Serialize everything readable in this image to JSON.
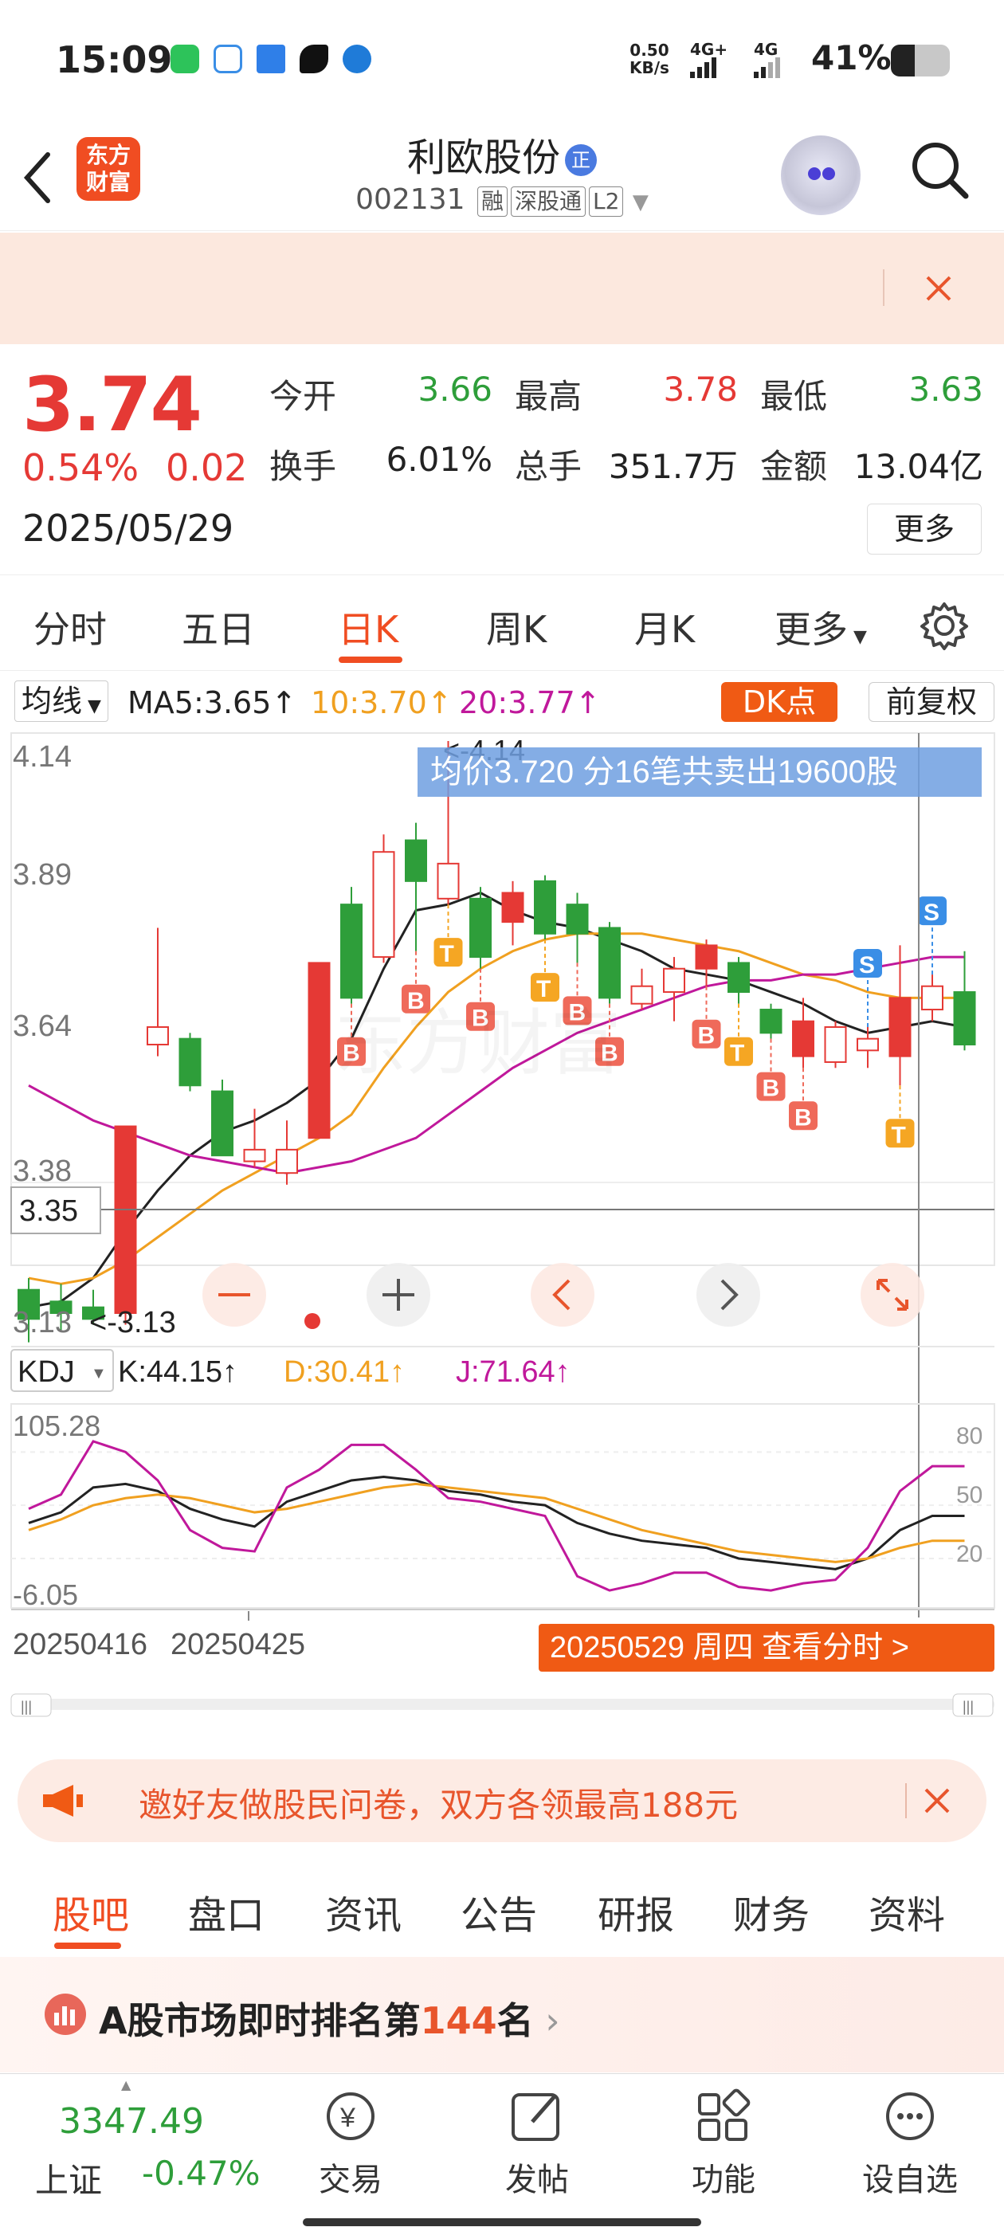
{
  "status": {
    "time": "15:09",
    "net_speed_value": "0.50",
    "net_speed_unit": "KB/s",
    "sig1": "4G+",
    "sig2": "4G",
    "battery": "41%",
    "battery_level": 0.41
  },
  "header": {
    "logo_line1": "东方",
    "logo_line2": "财富",
    "stock_name": "利欧股份",
    "badge": "正",
    "code": "002131",
    "tags": [
      "融",
      "深股通",
      "L2"
    ]
  },
  "quote": {
    "price": "3.74",
    "change_pct": "0.54%",
    "change": "0.02",
    "date": "2025/05/29",
    "fields": [
      {
        "key": "今开",
        "value": "3.66",
        "color": "#2e9e3a"
      },
      {
        "key": "最高",
        "value": "3.78",
        "color": "#e53935"
      },
      {
        "key": "最低",
        "value": "3.63",
        "color": "#2e9e3a"
      },
      {
        "key": "换手",
        "value": "6.01%",
        "color": "#222222"
      },
      {
        "key": "总手",
        "value": "351.7万",
        "color": "#222222"
      },
      {
        "key": "金额",
        "value": "13.04亿",
        "color": "#222222"
      }
    ],
    "more": "更多"
  },
  "tabs": [
    "分时",
    "五日",
    "日K",
    "周K",
    "月K",
    "更多"
  ],
  "active_tab": "日K",
  "ma": {
    "selector": "均线",
    "ma5": "MA5:3.65",
    "ma10": "10:3.70",
    "ma20": "20:3.77",
    "dk": "DK点",
    "fq": "前复权"
  },
  "kline": {
    "y_labels": [
      "4.14",
      "3.89",
      "3.64",
      "3.38",
      "3.13"
    ],
    "crosshair_price": "3.35",
    "high_marker": "<-4.14",
    "low_marker": "<-3.13",
    "tooltip": "均价3.720  分16笔共卖出19600股"
  },
  "kdj": {
    "selector": "KDJ",
    "k": "K:44.15",
    "d": "D:30.41",
    "j": "J:71.64",
    "y_top": "105.28",
    "y_bottom": "-6.05",
    "levels": [
      "80",
      "50",
      "20"
    ]
  },
  "x_axis": {
    "labels": [
      "20250416",
      "20250425"
    ],
    "current": "20250529 周四 查看分时 >"
  },
  "promo": {
    "text": "邀好友做股民问卷，双方各领最高188元"
  },
  "section_tabs": [
    "股吧",
    "盘口",
    "资讯",
    "公告",
    "研报",
    "财务",
    "资料"
  ],
  "active_section": "股吧",
  "rank": {
    "prefix": "A股市场即时排名第",
    "number": "144",
    "suffix": "名"
  },
  "bottom": {
    "index_value": "3347.49",
    "index_name": "上证",
    "index_change": "-0.47%",
    "items": [
      "交易",
      "发帖",
      "功能",
      "设自选"
    ]
  },
  "colors": {
    "up": "#e53935",
    "down": "#2e9e3a",
    "accent": "#f04d22",
    "ma5": "#222222",
    "ma10": "#f0a020",
    "ma20": "#c0189b"
  },
  "chart_data": {
    "type": "candlestick",
    "x_start": "20250416",
    "x_end": "20250529",
    "ylim": [
      3.13,
      4.14
    ],
    "candles": [
      {
        "o": 3.2,
        "c": 3.15,
        "h": 3.22,
        "l": 3.11
      },
      {
        "o": 3.18,
        "c": 3.16,
        "h": 3.21,
        "l": 3.13
      },
      {
        "o": 3.17,
        "c": 3.15,
        "h": 3.2,
        "l": 3.14
      },
      {
        "o": 3.16,
        "c": 3.48,
        "h": 3.48,
        "l": 3.14
      },
      {
        "o": 3.62,
        "c": 3.65,
        "h": 3.82,
        "l": 3.6
      },
      {
        "o": 3.63,
        "c": 3.55,
        "h": 3.64,
        "l": 3.54
      },
      {
        "o": 3.54,
        "c": 3.43,
        "h": 3.56,
        "l": 3.43
      },
      {
        "o": 3.42,
        "c": 3.44,
        "h": 3.51,
        "l": 3.41
      },
      {
        "o": 3.4,
        "c": 3.44,
        "h": 3.49,
        "l": 3.38
      },
      {
        "o": 3.46,
        "c": 3.76,
        "h": 3.76,
        "l": 3.46
      },
      {
        "o": 3.86,
        "c": 3.7,
        "h": 3.89,
        "l": 3.69
      },
      {
        "o": 3.77,
        "c": 3.95,
        "h": 3.98,
        "l": 3.76
      },
      {
        "o": 3.97,
        "c": 3.9,
        "h": 4.0,
        "l": 3.78
      },
      {
        "o": 3.87,
        "c": 3.93,
        "h": 4.14,
        "l": 3.86
      },
      {
        "o": 3.87,
        "c": 3.77,
        "h": 3.89,
        "l": 3.75
      },
      {
        "o": 3.83,
        "c": 3.88,
        "h": 3.9,
        "l": 3.79
      },
      {
        "o": 3.9,
        "c": 3.81,
        "h": 3.91,
        "l": 3.8
      },
      {
        "o": 3.86,
        "c": 3.81,
        "h": 3.88,
        "l": 3.76
      },
      {
        "o": 3.82,
        "c": 3.7,
        "h": 3.83,
        "l": 3.69
      },
      {
        "o": 3.69,
        "c": 3.72,
        "h": 3.75,
        "l": 3.68
      },
      {
        "o": 3.71,
        "c": 3.75,
        "h": 3.77,
        "l": 3.66
      },
      {
        "o": 3.75,
        "c": 3.79,
        "h": 3.8,
        "l": 3.72
      },
      {
        "o": 3.76,
        "c": 3.71,
        "h": 3.77,
        "l": 3.69
      },
      {
        "o": 3.68,
        "c": 3.64,
        "h": 3.69,
        "l": 3.63
      },
      {
        "o": 3.6,
        "c": 3.66,
        "h": 3.7,
        "l": 3.58
      },
      {
        "o": 3.59,
        "c": 3.65,
        "h": 3.66,
        "l": 3.58
      },
      {
        "o": 3.61,
        "c": 3.63,
        "h": 3.65,
        "l": 3.58
      },
      {
        "o": 3.6,
        "c": 3.7,
        "h": 3.79,
        "l": 3.55
      },
      {
        "o": 3.68,
        "c": 3.72,
        "h": 3.74,
        "l": 3.66
      },
      {
        "o": 3.71,
        "c": 3.62,
        "h": 3.78,
        "l": 3.61
      }
    ],
    "ma5": [
      3.17,
      3.18,
      3.22,
      3.3,
      3.37,
      3.43,
      3.47,
      3.49,
      3.52,
      3.56,
      3.63,
      3.75,
      3.85,
      3.86,
      3.88,
      3.85,
      3.83,
      3.82,
      3.8,
      3.78,
      3.75,
      3.74,
      3.73,
      3.71,
      3.69,
      3.66,
      3.64,
      3.65,
      3.66,
      3.65
    ],
    "ma10": [
      3.22,
      3.21,
      3.22,
      3.25,
      3.29,
      3.33,
      3.37,
      3.4,
      3.43,
      3.46,
      3.5,
      3.58,
      3.65,
      3.71,
      3.75,
      3.78,
      3.8,
      3.81,
      3.81,
      3.81,
      3.8,
      3.79,
      3.78,
      3.76,
      3.74,
      3.73,
      3.71,
      3.7,
      3.7,
      3.7
    ],
    "ma20": [
      3.55,
      3.52,
      3.49,
      3.47,
      3.45,
      3.43,
      3.42,
      3.41,
      3.4,
      3.41,
      3.42,
      3.44,
      3.46,
      3.5,
      3.54,
      3.58,
      3.61,
      3.64,
      3.66,
      3.68,
      3.7,
      3.72,
      3.73,
      3.73,
      3.74,
      3.74,
      3.75,
      3.76,
      3.77,
      3.77
    ],
    "signals": [
      {
        "i": 10,
        "t": "B"
      },
      {
        "i": 12,
        "t": "B"
      },
      {
        "i": 13,
        "t": "T"
      },
      {
        "i": 14,
        "t": "B"
      },
      {
        "i": 16,
        "t": "T"
      },
      {
        "i": 17,
        "t": "B"
      },
      {
        "i": 18,
        "t": "B"
      },
      {
        "i": 21,
        "t": "B"
      },
      {
        "i": 22,
        "t": "T"
      },
      {
        "i": 23,
        "t": "B"
      },
      {
        "i": 24,
        "t": "B"
      },
      {
        "i": 27,
        "t": "T"
      },
      {
        "i": 26,
        "t": "S"
      },
      {
        "i": 28,
        "t": "S"
      }
    ],
    "kdj_k": [
      40,
      46,
      60,
      62,
      58,
      48,
      42,
      38,
      52,
      58,
      64,
      66,
      64,
      58,
      56,
      52,
      50,
      40,
      34,
      30,
      28,
      26,
      20,
      18,
      16,
      14,
      20,
      36,
      44,
      44
    ],
    "kdj_d": [
      36,
      42,
      50,
      54,
      56,
      54,
      50,
      46,
      48,
      52,
      56,
      60,
      62,
      60,
      58,
      56,
      54,
      48,
      42,
      36,
      32,
      28,
      24,
      22,
      20,
      18,
      20,
      26,
      30,
      30
    ],
    "kdj_j": [
      48,
      56,
      86,
      80,
      64,
      36,
      26,
      24,
      60,
      70,
      84,
      84,
      70,
      54,
      52,
      48,
      44,
      10,
      2,
      6,
      12,
      12,
      4,
      2,
      6,
      8,
      26,
      58,
      72,
      72
    ],
    "kdj_ylim": [
      -6.05,
      105.28
    ]
  }
}
